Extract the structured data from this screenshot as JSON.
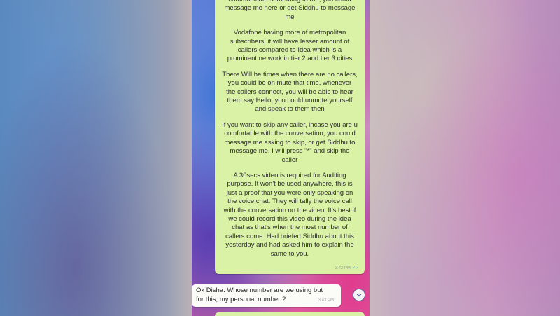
{
  "chat": {
    "incoming_message": {
      "paragraphs": [
        "communicate something to me, you could\nmessage me here or get Siddhu to message\nme",
        "Vodafone having more of metropolitan\nsubscribers, it will have lesser amount of\ncallers compared to Idea which is a\nprominent network in tier 2 and tier 3 cities",
        "There Will be times when there are no callers,\nyou could be on mute that time, whenever\nthe callers connect, you will be able to hear\nthem say Hello, you could unmute yourself\nand speak to them then",
        "If you want to skip any caller, incase you are u\ncomfortable with the conversation, you could\nmessage me asking to skip, or get Siddhu to\nmessage me, I will press \"*\" and skip the\ncaller",
        "A 30secs video is required for Auditing\npurpose. It won't be used anywhere, this is\njust a proof that you were only speaking on\nthe voice chat. They will tally the voice call\nwith the conversation on the video. It's best if\nwe could record this video during the idea\nchat as that's when the most number of\ncallers come. Had briefed Siddhu about this\nyesterday and had asked him to explain the\nsame to you."
      ],
      "time": "3:42 PM",
      "ticks": "✓✓"
    },
    "outgoing_message": {
      "text": "Ok Disha. Whose number are we using but\nfor this, my personal number ?",
      "time": "3:43 PM"
    },
    "icons": {
      "scroll_down": "chevron-down-icon"
    },
    "colors": {
      "incoming_bubble": "#d9f2a6",
      "outgoing_bubble": "#fbfbf8",
      "read_ticks": "#4fb3e6"
    }
  }
}
